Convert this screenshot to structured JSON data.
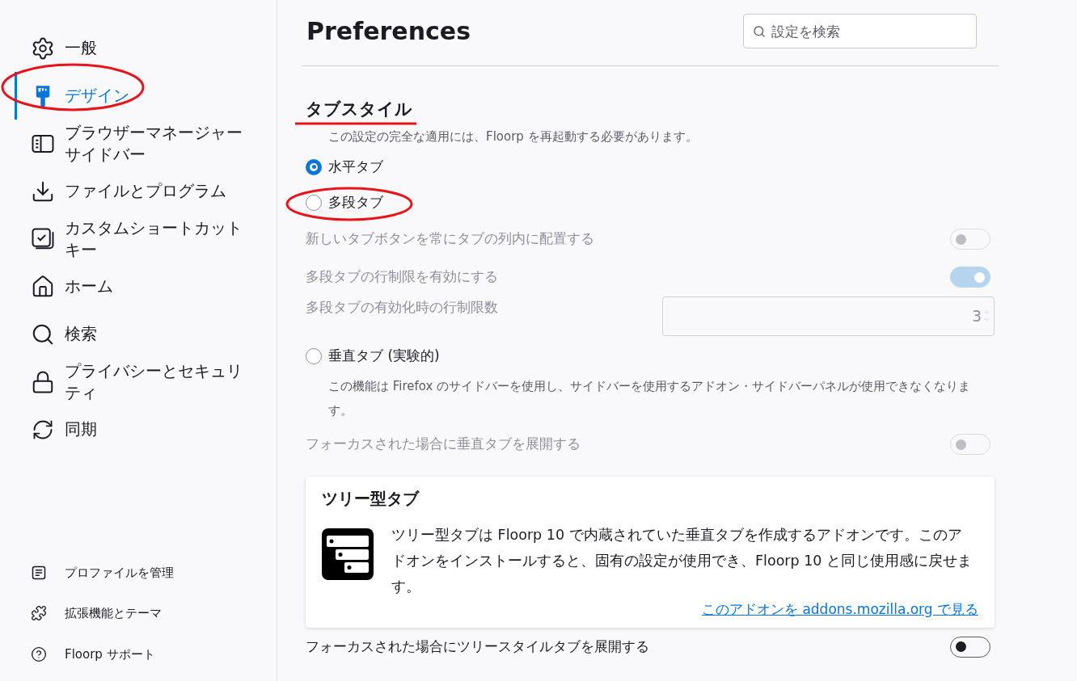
{
  "sidebar": {
    "items": [
      {
        "label": "一般",
        "selected": false
      },
      {
        "label": "デザイン",
        "selected": true
      },
      {
        "label": "ブラウザーマネージャーサイドバー",
        "selected": false
      },
      {
        "label": "ファイルとプログラム",
        "selected": false
      },
      {
        "label": "カスタムショートカットキー",
        "selected": false
      },
      {
        "label": "ホーム",
        "selected": false
      },
      {
        "label": "検索",
        "selected": false
      },
      {
        "label": "プライバシーとセキュリティ",
        "selected": false
      },
      {
        "label": "同期",
        "selected": false
      }
    ],
    "footer_links": [
      {
        "label": "プロファイルを管理"
      },
      {
        "label": "拡張機能とテーマ"
      },
      {
        "label": "Floorp サポート"
      }
    ]
  },
  "header": {
    "title": "Preferences",
    "search": {
      "placeholder": "設定を検索"
    }
  },
  "section": {
    "title": "タブスタイル",
    "note": "この設定の完全な適用には、Floorp を再起動する必要があります。",
    "options": [
      {
        "kind": "radio",
        "label": "水平タブ",
        "selected": true
      },
      {
        "kind": "radio",
        "label": "多段タブ",
        "selected": false
      },
      {
        "kind": "toggle",
        "label": "新しいタブボタンを常にタブの列内に配置する",
        "on": false,
        "disabled": true
      },
      {
        "kind": "toggle",
        "label": "多段タブの行制限を有効にする",
        "on": true,
        "disabled": true
      },
      {
        "kind": "number",
        "label": "多段タブの有効化時の行制限数",
        "value": "3",
        "disabled": true
      },
      {
        "kind": "radio",
        "label": "垂直タブ (実験的)",
        "selected": false
      },
      {
        "kind": "description",
        "label": "この機能は Firefox のサイドバーを使用し、サイドバーを使用するアドオン・サイドバーパネルが使用できなくなります。"
      },
      {
        "kind": "toggle",
        "label": "フォーカスされた場合に垂直タブを展開する",
        "on": false,
        "disabled": true
      }
    ]
  },
  "addon_card": {
    "title": "ツリー型タブ",
    "body": "ツリー型タブは Floorp 10 で内蔵されていた垂直タブを作成するアドオンです。このアドオンをインストールすると、固有の設定が使用でき、Floorp 10 と同じ使用感に戻せます。",
    "link": "このアドオンを addons.mozilla.org で見る"
  },
  "bottom_option": {
    "kind": "toggle",
    "label": "フォーカスされた場合にツリースタイルタブを展開する",
    "on": false,
    "disabled": false
  }
}
